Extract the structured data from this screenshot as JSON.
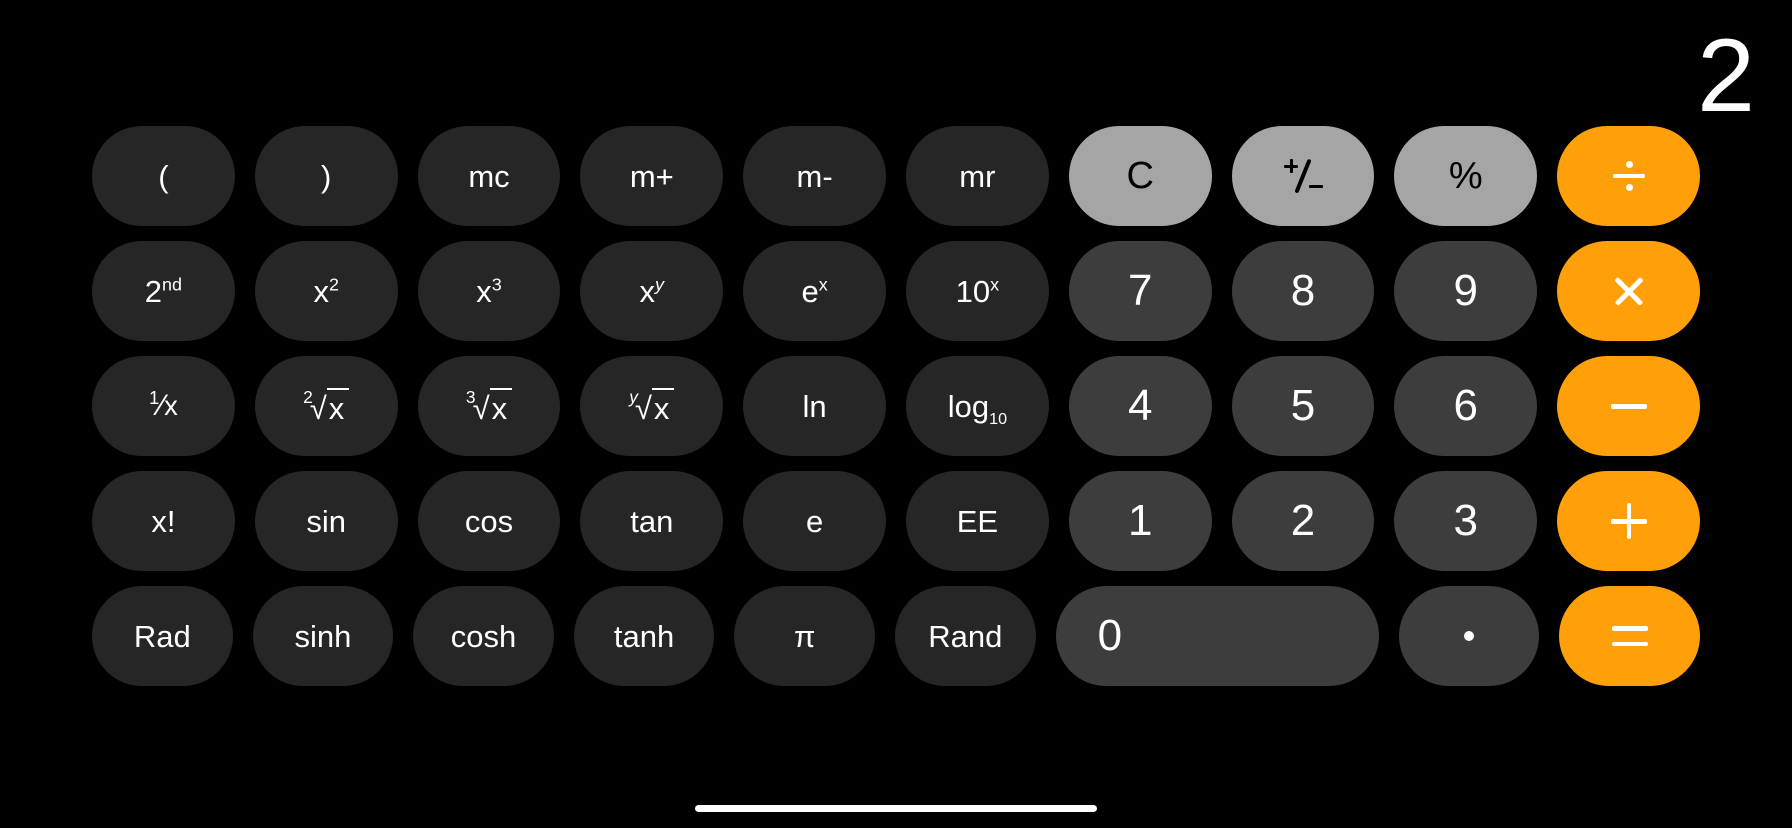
{
  "app": {
    "name": "Calculator",
    "mode": "scientific-landscape",
    "background_color": "#000000"
  },
  "display": {
    "value": "2"
  },
  "colors": {
    "background": "#000000",
    "function_key": "#262626",
    "digit_key": "#3d3d3d",
    "utility_key": "#a5a5a5",
    "operator_key": "#ff9f0a",
    "text_light": "#ffffff",
    "text_dark": "#000000",
    "home_indicator": "#ffffff"
  },
  "keypad": {
    "rows": [
      {
        "keys": [
          {
            "name": "open-paren",
            "label": "(",
            "style": "fn"
          },
          {
            "name": "close-paren",
            "label": ")",
            "style": "fn"
          },
          {
            "name": "memory-clear",
            "label": "mc",
            "style": "fn"
          },
          {
            "name": "memory-add",
            "label": "m+",
            "style": "fn"
          },
          {
            "name": "memory-subtract",
            "label": "m-",
            "style": "fn"
          },
          {
            "name": "memory-recall",
            "label": "mr",
            "style": "fn"
          },
          {
            "name": "clear",
            "label": "C",
            "style": "util"
          },
          {
            "name": "plus-minus",
            "label": "+/-",
            "style": "util"
          },
          {
            "name": "percent",
            "label": "%",
            "style": "util"
          },
          {
            "name": "divide",
            "label": "÷",
            "style": "op"
          }
        ]
      },
      {
        "keys": [
          {
            "name": "second-function",
            "label": "2nd",
            "style": "fn"
          },
          {
            "name": "x-squared",
            "label": "x²",
            "style": "fn"
          },
          {
            "name": "x-cubed",
            "label": "x³",
            "style": "fn"
          },
          {
            "name": "x-power-y",
            "label": "xʸ",
            "style": "fn"
          },
          {
            "name": "e-power-x",
            "label": "eˣ",
            "style": "fn"
          },
          {
            "name": "ten-power-x",
            "label": "10ˣ",
            "style": "fn"
          },
          {
            "name": "digit-7",
            "label": "7",
            "style": "digit"
          },
          {
            "name": "digit-8",
            "label": "8",
            "style": "digit"
          },
          {
            "name": "digit-9",
            "label": "9",
            "style": "digit"
          },
          {
            "name": "multiply",
            "label": "×",
            "style": "op"
          }
        ]
      },
      {
        "keys": [
          {
            "name": "reciprocal",
            "label": "1/x",
            "style": "fn"
          },
          {
            "name": "square-root",
            "label": "²√x",
            "style": "fn"
          },
          {
            "name": "cube-root",
            "label": "³√x",
            "style": "fn"
          },
          {
            "name": "nth-root",
            "label": "ʸ√x",
            "style": "fn"
          },
          {
            "name": "natural-log",
            "label": "ln",
            "style": "fn"
          },
          {
            "name": "log-base-10",
            "label": "log₁₀",
            "style": "fn"
          },
          {
            "name": "digit-4",
            "label": "4",
            "style": "digit"
          },
          {
            "name": "digit-5",
            "label": "5",
            "style": "digit"
          },
          {
            "name": "digit-6",
            "label": "6",
            "style": "digit"
          },
          {
            "name": "subtract",
            "label": "−",
            "style": "op"
          }
        ]
      },
      {
        "keys": [
          {
            "name": "factorial",
            "label": "x!",
            "style": "fn"
          },
          {
            "name": "sine",
            "label": "sin",
            "style": "fn"
          },
          {
            "name": "cosine",
            "label": "cos",
            "style": "fn"
          },
          {
            "name": "tangent",
            "label": "tan",
            "style": "fn"
          },
          {
            "name": "eulers-number",
            "label": "e",
            "style": "fn"
          },
          {
            "name": "exponent-ee",
            "label": "EE",
            "style": "fn"
          },
          {
            "name": "digit-1",
            "label": "1",
            "style": "digit"
          },
          {
            "name": "digit-2",
            "label": "2",
            "style": "digit"
          },
          {
            "name": "digit-3",
            "label": "3",
            "style": "digit"
          },
          {
            "name": "add",
            "label": "+",
            "style": "op"
          }
        ]
      },
      {
        "keys": [
          {
            "name": "radians-toggle",
            "label": "Rad",
            "style": "fn"
          },
          {
            "name": "hyperbolic-sine",
            "label": "sinh",
            "style": "fn"
          },
          {
            "name": "hyperbolic-cosine",
            "label": "cosh",
            "style": "fn"
          },
          {
            "name": "hyperbolic-tangent",
            "label": "tanh",
            "style": "fn"
          },
          {
            "name": "pi",
            "label": "π",
            "style": "fn"
          },
          {
            "name": "random",
            "label": "Rand",
            "style": "fn"
          },
          {
            "name": "digit-0",
            "label": "0",
            "style": "digit wide"
          },
          {
            "name": "decimal-point",
            "label": ".",
            "style": "digit"
          },
          {
            "name": "equals",
            "label": "=",
            "style": "op"
          }
        ]
      }
    ]
  },
  "home_indicator": {
    "label": "home-indicator"
  }
}
